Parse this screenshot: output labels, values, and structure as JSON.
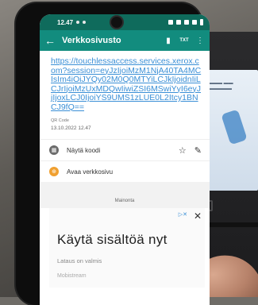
{
  "status_bar": {
    "time": "12.47"
  },
  "app_bar": {
    "back_icon": "←",
    "title": "Verkkosivusto",
    "trash_icon": "▮",
    "txt_icon": "TXT",
    "more_icon": "⋮"
  },
  "content": {
    "url": "https://touchlessaccess.services.xerox.com?session=eyJzIjoiMzM1NjA40TA4MCIsIm4iOiJYQy02M0Q0MTYiLCJkIjoidnIiLCJrIjoiMzUxMDQwIiwiZSI6MSwiYyI6eyJjIjoxLCJ0IjoiYS9UMS1zLUE0L2Itcy1BNCJ9fQ==",
    "type_label": "QR Code",
    "date": "13.10.2022 12.47"
  },
  "actions": [
    {
      "label": "Näytä koodi",
      "icon": "qr-icon"
    },
    {
      "label": "Avaa verkkosivu",
      "icon": "globe-icon"
    }
  ],
  "action_icons": {
    "star": "☆",
    "edit": "✎"
  },
  "ad": {
    "section_label": "Mainonta",
    "adchoices": "▷✕",
    "close": "✕",
    "headline": "Käytä sisältöä nyt",
    "subline": "Lataus on valmis",
    "brand": "Mobistream"
  },
  "colors": {
    "status_bar": "#0f6b5c",
    "app_bar": "#128c7e",
    "link": "#3a8fd6",
    "accent": "#f0a030"
  }
}
